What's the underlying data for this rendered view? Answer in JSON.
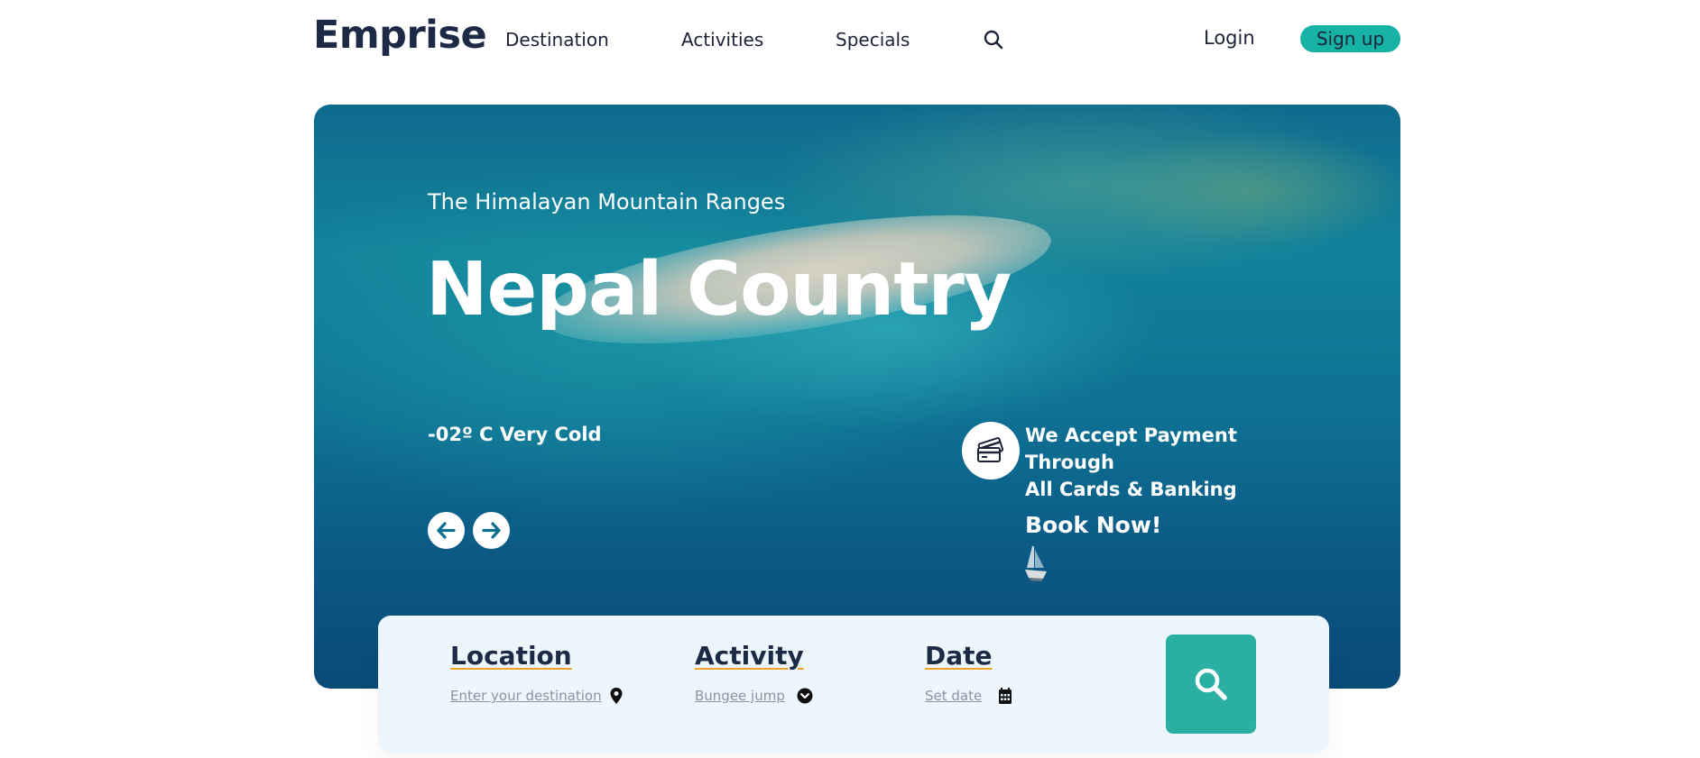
{
  "header": {
    "logo": "Emprise",
    "nav": [
      "Destination",
      "Activities",
      "Specials"
    ],
    "search_icon": "search-icon",
    "login": "Login",
    "signup": "Sign up"
  },
  "hero": {
    "subtitle": "The Himalayan Mountain Ranges",
    "title": "Nepal Country",
    "weather": "-02º C Very Cold",
    "payment_line1": "We Accept Payment Through",
    "payment_line2": "All Cards & Banking",
    "payment_icon": "credit-cards-icon",
    "book_now": "Book Now!",
    "prev_icon": "arrow-left-icon",
    "next_icon": "arrow-right-icon"
  },
  "search_panel": {
    "location": {
      "title": "Location",
      "value": "Enter your destination",
      "icon": "map-pin-icon"
    },
    "activity": {
      "title": "Activity",
      "value": "Bungee jump",
      "icon": "chevron-down-icon"
    },
    "date": {
      "title": "Date",
      "value": "Set date",
      "icon": "calendar-icon"
    },
    "search_icon": "search-icon"
  },
  "colors": {
    "accent": "#16b2a6",
    "search_button": "#2ab0a2",
    "heading": "#1c2a45",
    "underline": "#f2a023",
    "panel_bg": "#eef6fd"
  }
}
